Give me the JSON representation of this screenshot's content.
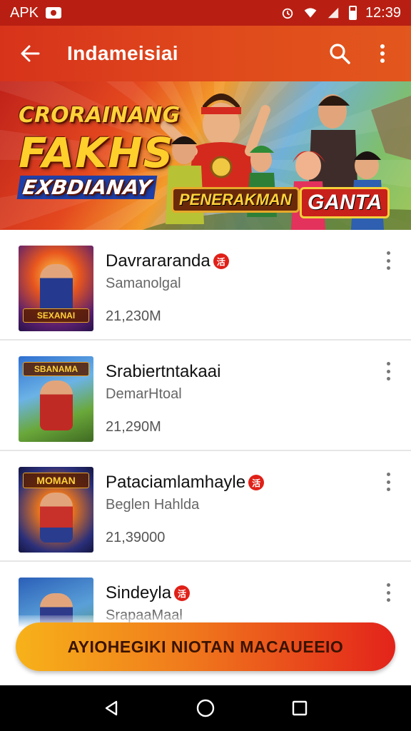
{
  "status_bar": {
    "left_label": "APK",
    "time": "12:39",
    "icons": [
      "message-icon",
      "alarm-icon",
      "wifi-icon",
      "signal-icon",
      "battery-icon"
    ]
  },
  "app_bar": {
    "title": "Indameisiai",
    "icons": [
      "back-arrow-icon",
      "search-icon",
      "more-vert-icon"
    ]
  },
  "banner": {
    "line1": "CRORAINANG",
    "line2": "FAKHS",
    "line3": "EXBDIANAY",
    "badge_left": "PENERAKMAN",
    "badge_right": "GANTA"
  },
  "list": {
    "items": [
      {
        "title": "Davrararanda",
        "subtitle": "Samanolgal",
        "count": "21,230M",
        "thumb_label": "SEXANAI",
        "badge": "活"
      },
      {
        "title": "Srabiertntakaai",
        "subtitle": "DemarHtoal",
        "count": "21,290M",
        "thumb_label": "SBANAMA",
        "badge": ""
      },
      {
        "title": "Pataciamlamhayle",
        "subtitle": "Beglen Hahlda",
        "count": "21,39000",
        "thumb_label": "MOMAN",
        "badge": "活"
      },
      {
        "title": "Sindeyla",
        "subtitle": "SrapaaMaal",
        "count": "",
        "thumb_label": "",
        "badge": "活"
      }
    ]
  },
  "cta": {
    "label": "AYIOHEGIKI NIOTAN MACAUEEIO"
  },
  "nav_bar": {
    "icons": [
      "back-triangle-icon",
      "home-circle-icon",
      "recents-square-icon"
    ]
  },
  "colors": {
    "primary": "#d7331b",
    "status_bar": "#b81f12",
    "cta_start": "#f7b21a",
    "cta_end": "#e3231b"
  }
}
